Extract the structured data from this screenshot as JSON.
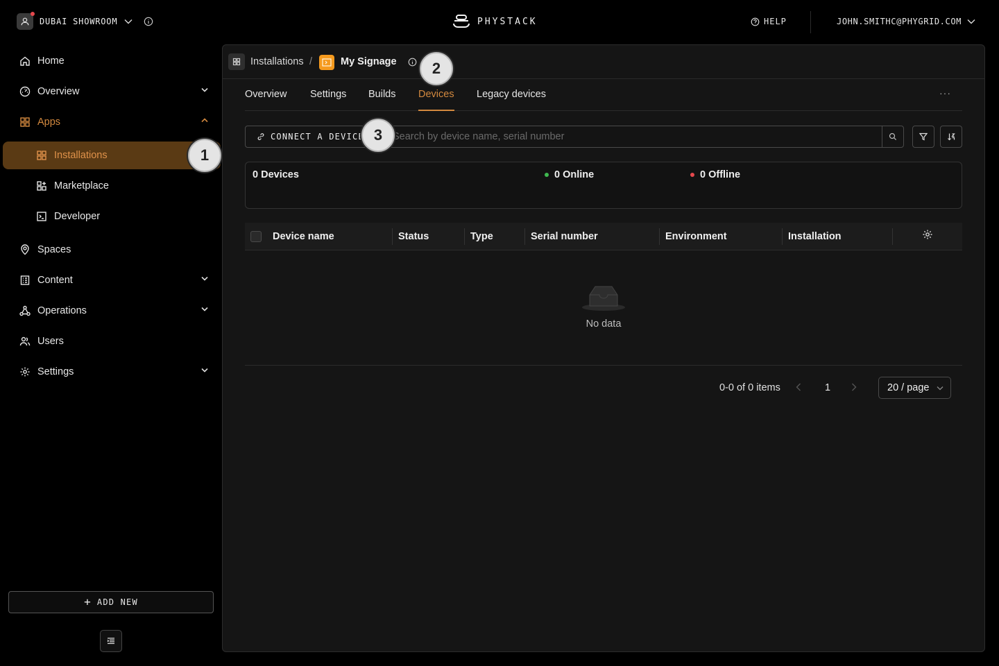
{
  "topbar": {
    "org_name": "DUBAI SHOWROOM",
    "logo_text": "PHYSTACK",
    "help_label": "HELP",
    "user_email": "JOHN.SMITHC@PHYGRID.COM"
  },
  "sidebar": {
    "items": [
      {
        "label": "Home",
        "icon": "home-icon"
      },
      {
        "label": "Overview",
        "icon": "gauge-icon"
      },
      {
        "label": "Apps",
        "icon": "grid-icon"
      },
      {
        "label": "Installations",
        "icon": "grid-icon"
      },
      {
        "label": "Marketplace",
        "icon": "apps-add-icon"
      },
      {
        "label": "Developer",
        "icon": "terminal-icon"
      },
      {
        "label": "Spaces",
        "icon": "location-pin-icon"
      },
      {
        "label": "Content",
        "icon": "document-icon"
      },
      {
        "label": "Operations",
        "icon": "network-icon"
      },
      {
        "label": "Users",
        "icon": "users-icon"
      },
      {
        "label": "Settings",
        "icon": "gear-icon"
      }
    ],
    "add_new_label": "ADD NEW"
  },
  "badges": {
    "one": "1",
    "two": "2",
    "three": "3"
  },
  "breadcrumb": {
    "parent": "Installations",
    "separator": "/",
    "current": "My Signage"
  },
  "tabs": [
    {
      "label": "Overview"
    },
    {
      "label": "Settings"
    },
    {
      "label": "Builds"
    },
    {
      "label": "Devices"
    },
    {
      "label": "Legacy devices"
    }
  ],
  "tabs_more": "···",
  "toolbar": {
    "connect_label": "CONNECT A DEVICE",
    "search_placeholder": "Search by device name, serial number"
  },
  "stats": {
    "total": "0 Devices",
    "online": "0 Online",
    "offline": "0 Offline"
  },
  "table": {
    "columns": [
      "Device name",
      "Status",
      "Type",
      "Serial number",
      "Environment",
      "Installation"
    ],
    "empty_text": "No data"
  },
  "pagination": {
    "total_text": "0-0 of 0 items",
    "current_page": "1",
    "page_size": "20 / page"
  },
  "colors": {
    "accent": "#d3893f",
    "active_bg": "#5a3a14",
    "online": "#3fb950",
    "offline": "#e5484d",
    "app_icon": "#f59a1e"
  }
}
